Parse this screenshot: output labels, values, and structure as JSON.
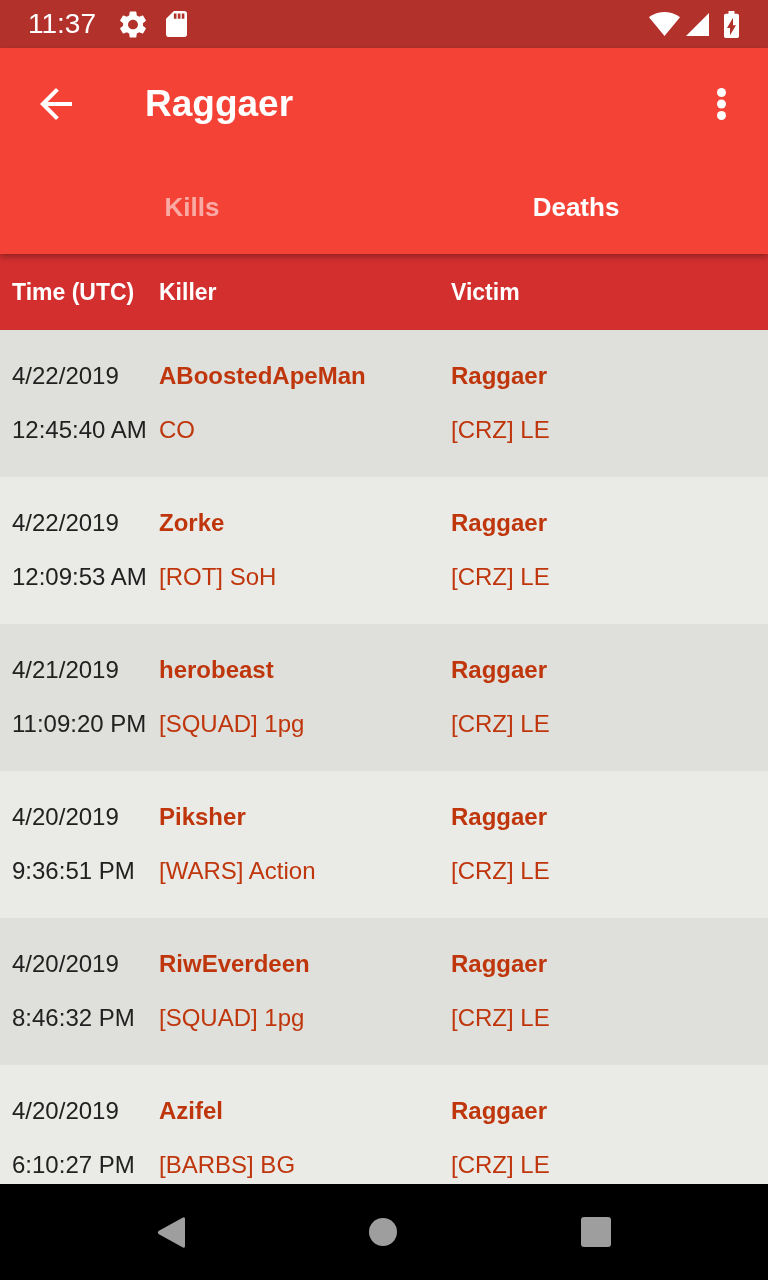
{
  "status_bar": {
    "time": "11:37"
  },
  "app_bar": {
    "title": "Raggaer"
  },
  "tabs": [
    {
      "label": "Kills",
      "selected": false
    },
    {
      "label": "Deaths",
      "selected": true
    }
  ],
  "table": {
    "columns": [
      "Time (UTC)",
      "Killer",
      "Victim"
    ],
    "rows": [
      {
        "date": "4/22/2019",
        "time": "12:45:40 AM",
        "killer": "ABoostedApeMan",
        "killer_guild": "CO",
        "victim": "Raggaer",
        "victim_guild": "[CRZ] LE"
      },
      {
        "date": "4/22/2019",
        "time": "12:09:53 AM",
        "killer": "Zorke",
        "killer_guild": "[ROT] SoH",
        "victim": "Raggaer",
        "victim_guild": "[CRZ] LE"
      },
      {
        "date": "4/21/2019",
        "time": "11:09:20 PM",
        "killer": "herobeast",
        "killer_guild": "[SQUAD] 1pg",
        "victim": "Raggaer",
        "victim_guild": "[CRZ] LE"
      },
      {
        "date": "4/20/2019",
        "time": "9:36:51 PM",
        "killer": "Piksher",
        "killer_guild": "[WARS] Action",
        "victim": "Raggaer",
        "victim_guild": "[CRZ] LE"
      },
      {
        "date": "4/20/2019",
        "time": "8:46:32 PM",
        "killer": "RiwEverdeen",
        "killer_guild": "[SQUAD] 1pg",
        "victim": "Raggaer",
        "victim_guild": "[CRZ] LE"
      },
      {
        "date": "4/20/2019",
        "time": "6:10:27 PM",
        "killer": "Azifel",
        "killer_guild": "[BARBS] BG",
        "victim": "Raggaer",
        "victim_guild": "[CRZ] LE"
      }
    ]
  }
}
